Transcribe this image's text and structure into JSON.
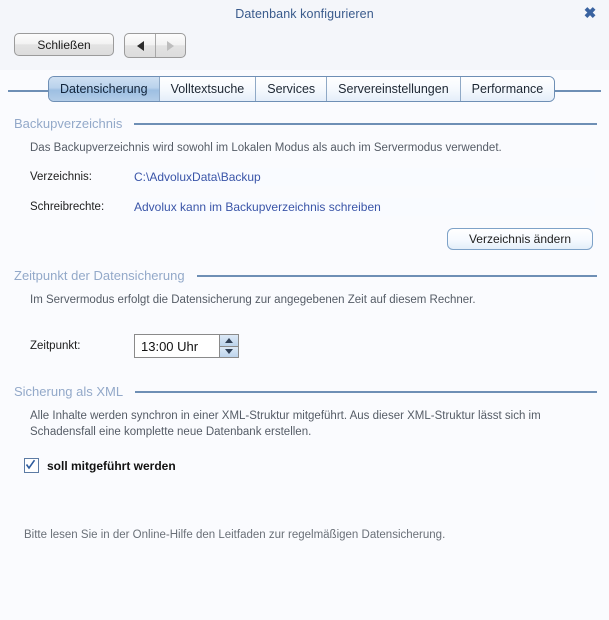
{
  "window": {
    "title": "Datenbank konfigurieren",
    "close_icon": "close-icon",
    "close_glyph": "✖"
  },
  "toolbar": {
    "close_label": "Schließen",
    "back_icon": "arrow-left-icon",
    "forward_icon": "arrow-right-icon"
  },
  "tabs": [
    {
      "label": "Datensicherung",
      "active": true
    },
    {
      "label": "Volltextsuche",
      "active": false
    },
    {
      "label": "Services",
      "active": false
    },
    {
      "label": "Servereinstellungen",
      "active": false
    },
    {
      "label": "Performance",
      "active": false
    }
  ],
  "sections": {
    "backup": {
      "legend": "Backupverzeichnis",
      "description": "Das Backupverzeichnis wird sowohl im Lokalen Modus als auch im Servermodus verwendet.",
      "fields": [
        {
          "label": "Verzeichnis:",
          "value": "C:\\AdvoluxData\\Backup"
        },
        {
          "label": "Schreibrechte:",
          "value": "Advolux kann im Backupverzeichnis schreiben"
        }
      ],
      "button_label": "Verzeichnis ändern"
    },
    "schedule": {
      "legend": "Zeitpunkt der Datensicherung",
      "description": "Im Servermodus erfolgt die Datensicherung zur angegebenen Zeit auf diesem Rechner.",
      "field_label": "Zeitpunkt:",
      "field_value": "13:00 Uhr",
      "spinner_up_icon": "spinner-up-icon",
      "spinner_down_icon": "spinner-down-icon"
    },
    "xml": {
      "legend": "Sicherung als XML",
      "description": "Alle Inhalte werden synchron in einer XML-Struktur mitgeführt. Aus dieser XML-Struktur lässt sich im Schadensfall eine komplette neue Datenbank erstellen.",
      "checkbox_label": "soll mitgeführt werden",
      "checkbox_checked": true,
      "check_icon": "checkmark-icon"
    }
  },
  "footnote": "Bitte lesen Sie in der Online-Hilfe den Leitfaden zur regelmäßigen Datensicherung.",
  "colors": {
    "accent": "#6e8fb5",
    "legend_text": "#93a9c9",
    "value_text": "#3a55a8",
    "background": "#fafbfe"
  }
}
